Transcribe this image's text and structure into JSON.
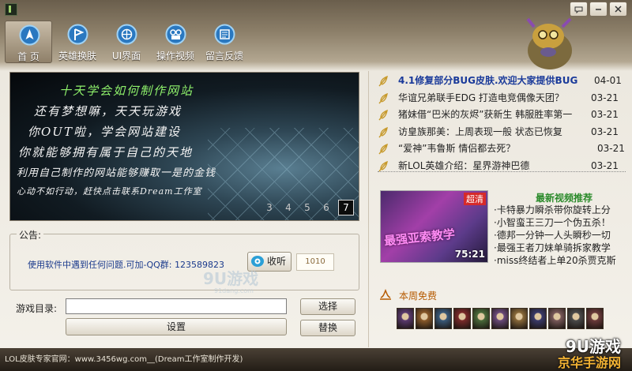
{
  "titlebar": {
    "buttons": [
      {
        "name": "skin-icon"
      },
      {
        "name": "minimize-icon"
      },
      {
        "name": "close-icon"
      }
    ]
  },
  "nav": [
    {
      "label": "首 页",
      "icon": "home-compass-icon",
      "active": true
    },
    {
      "label": "英雄换肤",
      "icon": "flag-icon",
      "active": false
    },
    {
      "label": "UI界面",
      "icon": "interface-globe-icon",
      "active": false
    },
    {
      "label": "操作视频",
      "icon": "video-icon",
      "active": false
    },
    {
      "label": "留言反馈",
      "icon": "feedback-icon",
      "active": false
    }
  ],
  "banner": {
    "lines": [
      "十天学会如何制作网站",
      "还有梦想嘛，天天玩游戏",
      "你OUT啦，学会网站建设",
      "你就能够拥有属于自己的天地",
      "利用自己制作的网站能够赚取一是的金钱",
      "心动不如行动，赶快点击联系Dream工作室"
    ],
    "pages": [
      "3",
      "4",
      "5",
      "6",
      "7"
    ],
    "active_page": "7"
  },
  "notice": {
    "title": "公告:",
    "text": "使用软件中遇到任何问题.可加-QQ群: 123589823",
    "listen_label": "收听",
    "count": "1010"
  },
  "watermark": {
    "line1": "9U游戏",
    "line2": "91dang.com"
  },
  "game_dir": {
    "label": "游戏目录:",
    "value": "",
    "select_label": "选择",
    "settings_label": "设置",
    "replace_label": "替换"
  },
  "status": {
    "text": "LOL皮肤专家官网：www.3456wg.com__(Dream工作室制作开发)"
  },
  "brand": {
    "line1": "9U游戏",
    "line2": "京华手游网"
  },
  "news": [
    {
      "title": "4.1修复部分BUG皮肤.欢迎大家提供BUG",
      "date": "04-01",
      "bold": true
    },
    {
      "title": "华谊兄弟联手EDG 打造电竞偶像天团？",
      "date": "03-21",
      "bold": false
    },
    {
      "title": "猪妹借“巴米的灰烬”获新生 韩服胜率第一",
      "date": "03-21",
      "bold": false
    },
    {
      "title": "访皇族那美：上周表现一般 状态已恢复",
      "date": "03-21",
      "bold": false
    },
    {
      "title": "“爱神”韦鲁斯 情侣都去死？",
      "date": "03-21",
      "bold": false
    },
    {
      "title": "新LOL英雄介绍：星界游神巴德",
      "date": "03-21",
      "bold": false
    }
  ],
  "video": {
    "heading": "最新视频推荐",
    "thumb_caption": "最强亚索教学",
    "badge": "超清",
    "duration": "75:21",
    "items": [
      "·卡特暴力瞬杀带你旋转上分",
      "·小智蛮王三刀一个伪五杀！",
      "·德邦一分钟一人头瞬秒一切",
      "·最强王者刀妹单骑拆家教学",
      "·miss终结者上单20杀贾克斯"
    ]
  },
  "free": {
    "heading": "本周免费",
    "hero_count": 11
  },
  "colors": {
    "accent": "#1a3a9a",
    "green": "#2a8a2a",
    "orange": "#b65a00",
    "brand_gold": "#f2b233"
  }
}
